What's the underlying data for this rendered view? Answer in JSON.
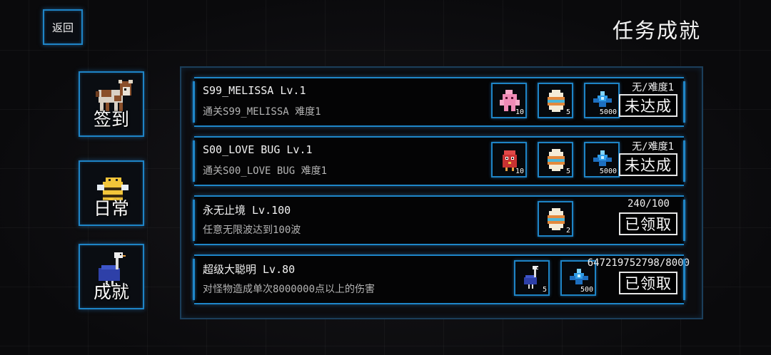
{
  "header": {
    "back_label": "返回",
    "title": "任务成就"
  },
  "sidebar": {
    "tabs": [
      {
        "label": "签到",
        "icon": "cow-icon",
        "selected": false
      },
      {
        "label": "日常",
        "icon": "bee-icon",
        "selected": false
      },
      {
        "label": "成就",
        "icon": "ostrich-icon",
        "selected": true
      }
    ]
  },
  "tasks": [
    {
      "title": "S99_MELISSA Lv.1",
      "desc": "通关S99_MELISSA 难度1",
      "progress": "无/难度1",
      "status": "未达成",
      "rewards": [
        {
          "icon": "pink-creature-icon",
          "qty": "10"
        },
        {
          "icon": "egg-icon",
          "qty": "5"
        },
        {
          "icon": "blue-crystal-icon",
          "qty": "5000"
        }
      ]
    },
    {
      "title": "S00_LOVE BUG Lv.1",
      "desc": "通关S00_LOVE BUG 难度1",
      "progress": "无/难度1",
      "status": "未达成",
      "rewards": [
        {
          "icon": "red-bird-icon",
          "qty": "10"
        },
        {
          "icon": "egg-icon",
          "qty": "5"
        },
        {
          "icon": "blue-crystal-icon",
          "qty": "5000"
        }
      ]
    },
    {
      "title": "永无止境 Lv.100",
      "desc": "任意无限波达到100波",
      "progress": "240/100",
      "status": "已领取",
      "rewards": [
        {
          "icon": "egg-icon",
          "qty": "2"
        }
      ]
    },
    {
      "title": "超级大聪明 Lv.80",
      "desc": "对怪物造成单次8000000点以上的伤害",
      "progress": "647219752798/8000",
      "status": "已领取",
      "rewards": [
        {
          "icon": "ostrich-icon",
          "qty": "5"
        },
        {
          "icon": "blue-crystal-icon",
          "qty": "500"
        }
      ]
    }
  ],
  "colors": {
    "frame_blue": "#1e84c6",
    "background": "#0b0b0d"
  }
}
